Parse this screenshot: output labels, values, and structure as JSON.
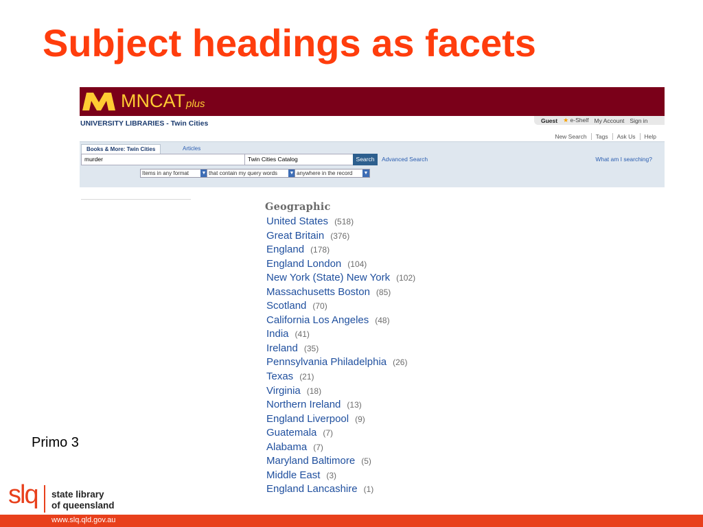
{
  "slide": {
    "title": "Subject headings as facets",
    "caption": "Primo 3"
  },
  "app": {
    "logo_text": "MNCAT",
    "logo_sub": "plus",
    "institution": "UNIVERSITY LIBRARIES - Twin Cities",
    "user_bar": {
      "guest": "Guest",
      "eshelf": "e-Shelf",
      "my_account": "My Account",
      "sign_in": "Sign in"
    },
    "nav": [
      "New Search",
      "Tags",
      "Ask Us",
      "Help"
    ],
    "tabs": {
      "books": "Books & More: Twin Cities",
      "articles": "Articles"
    },
    "search": {
      "query": "murder",
      "scope": "Twin Cities Catalog",
      "button": "Search",
      "advanced": "Advanced Search",
      "what": "What am I searching?"
    },
    "filters": [
      "Items in any format",
      "that contain my query words",
      "anywhere in the record"
    ]
  },
  "facets": {
    "heading": "Geographic",
    "items": [
      {
        "label": "United States",
        "count": "(518)"
      },
      {
        "label": "Great Britain",
        "count": "(376)"
      },
      {
        "label": "England",
        "count": "(178)"
      },
      {
        "label": "England London",
        "count": "(104)"
      },
      {
        "label": "New York (State) New York",
        "count": "(102)"
      },
      {
        "label": "Massachusetts Boston",
        "count": "(85)"
      },
      {
        "label": "Scotland",
        "count": "(70)"
      },
      {
        "label": "California Los Angeles",
        "count": "(48)"
      },
      {
        "label": "India",
        "count": "(41)"
      },
      {
        "label": "Ireland",
        "count": "(35)"
      },
      {
        "label": "Pennsylvania Philadelphia",
        "count": "(26)"
      },
      {
        "label": "Texas",
        "count": "(21)"
      },
      {
        "label": "Virginia",
        "count": "(18)"
      },
      {
        "label": "Northern Ireland",
        "count": "(13)"
      },
      {
        "label": "England Liverpool",
        "count": "(9)"
      },
      {
        "label": "Guatemala",
        "count": "(7)"
      },
      {
        "label": "Alabama",
        "count": "(7)"
      },
      {
        "label": "Maryland Baltimore",
        "count": "(5)"
      },
      {
        "label": "Middle East",
        "count": "(3)"
      },
      {
        "label": "England Lancashire",
        "count": "(1)"
      }
    ]
  },
  "footer": {
    "mark": "slq",
    "name_line1": "state library",
    "name_line2": "of queensland",
    "url": "www.slq.qld.gov.au"
  },
  "colors": {
    "title": "#ff3d0d",
    "banner": "#7a0019",
    "logo": "#ffcc33",
    "facet_link": "#1f4f9e",
    "footer": "#e8401c"
  }
}
